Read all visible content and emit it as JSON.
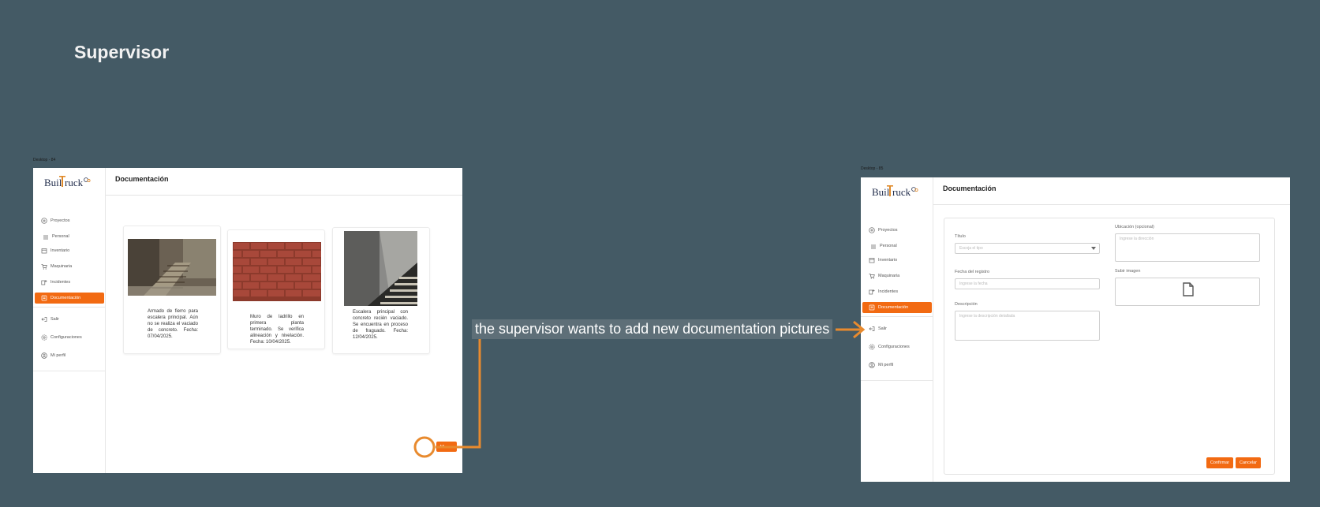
{
  "page": {
    "title": "Supervisor"
  },
  "annotation": {
    "text": "the supervisor wants to add new documentation pictures"
  },
  "colors": {
    "background": "#445a65",
    "accent": "#f26a12",
    "connector": "#e88a2e"
  },
  "frame1": {
    "label": "Desktop - 84",
    "header_title": "Documentación",
    "add_button_label": "Añ",
    "nav": [
      {
        "label": "Proyectos",
        "icon": "plus-circle-icon"
      },
      {
        "label": "Personal",
        "icon": "people-icon"
      },
      {
        "label": "Inventario",
        "icon": "box-icon"
      },
      {
        "label": "Maquinaria",
        "icon": "cart-icon"
      },
      {
        "label": "Incidentes",
        "icon": "incident-icon"
      },
      {
        "label": "Documentación",
        "icon": "document-icon",
        "active": true
      },
      {
        "label": "Salir",
        "icon": "logout-icon"
      },
      {
        "label": "Configuraciones",
        "icon": "gear-icon"
      },
      {
        "label": "Mi perfil",
        "icon": "user-icon"
      }
    ],
    "cards": [
      {
        "caption": "Armado de fierro para escalera principal. Aún no se realiza el vaciado de concreto. Fecha: 07/04/2025."
      },
      {
        "caption": "Muro de ladrillo en primera planta terminado. Se verifica alineación y nivelación. Fecha: 10/04/2025."
      },
      {
        "caption": "Escalera principal con concreto recién vaciado. Se encuentra en proceso de fraguado. Fecha: 12/04/2025."
      }
    ]
  },
  "frame2": {
    "label": "Desktop - 85",
    "header_title": "Documentación",
    "nav": [
      {
        "label": "Proyectos",
        "icon": "plus-circle-icon"
      },
      {
        "label": "Personal",
        "icon": "people-icon"
      },
      {
        "label": "Inventario",
        "icon": "box-icon"
      },
      {
        "label": "Maquinaria",
        "icon": "cart-icon"
      },
      {
        "label": "Incidentes",
        "icon": "incident-icon"
      },
      {
        "label": "Documentación",
        "icon": "document-icon",
        "active": true
      },
      {
        "label": "Salir",
        "icon": "logout-icon"
      },
      {
        "label": "Configuraciones",
        "icon": "gear-icon"
      },
      {
        "label": "Mi perfil",
        "icon": "user-icon"
      }
    ],
    "form": {
      "titulo_label": "Título",
      "titulo_placeholder": "Escoja el tipo",
      "fecha_label": "Fecha del registro",
      "fecha_placeholder": "Ingrese la fecha",
      "descripcion_label": "Descripción",
      "descripcion_placeholder": "Ingrese la descripción detallada",
      "ubicacion_label": "Ubicación (opcional)",
      "ubicacion_placeholder": "Ingrese la dirección",
      "imagen_label": "Subir imagen",
      "confirm_label": "Confirmar",
      "cancel_label": "Cancelar"
    }
  }
}
